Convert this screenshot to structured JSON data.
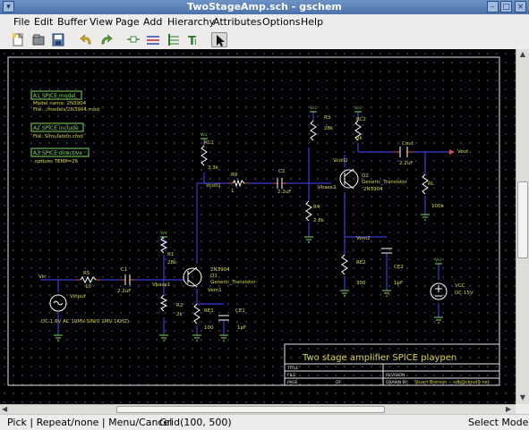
{
  "window": {
    "title": "TwoStageAmp.sch - gschem"
  },
  "menu": [
    "File",
    "Edit",
    "Buffer",
    "View",
    "Page",
    "Add",
    "Hierarchy",
    "Attributes",
    "Options",
    "Help"
  ],
  "toolbar": {
    "buttons": [
      "new-file-icon",
      "open-file-icon",
      "save-icon",
      "undo-icon",
      "redo-icon",
      "add-component-icon",
      "add-net-icon",
      "add-bus-icon",
      "add-text-icon",
      "select-pointer-icon"
    ]
  },
  "schematic": {
    "spice_blocks": [
      {
        "head": "A1  SPICE model",
        "l1": "Model name: 2N3904",
        "l2": "File: ./models/2N3904.mod"
      },
      {
        "head": "A2  SPICE include",
        "l1": "File: Simulation.cmd",
        "l2": ""
      },
      {
        "head": "A3  SPICE directive",
        "l1": ".options TEMP=25",
        "l2": ""
      }
    ],
    "labels": {
      "vin": "Vin",
      "vinput": "Vinput",
      "vsrc_value": "DC 1.6V AC 10MV SIN(0 1MV 1KHZ)",
      "r5": "R5",
      "r5v": "10",
      "c1": "C1",
      "c1v": "2.2uF",
      "vbase1": "Vbase1",
      "r1": "R1",
      "r1v": "28k",
      "r2": "R2",
      "r2v": "2k",
      "rc1": "RC1",
      "rc1v": "3.3k",
      "vcoll1": "Vcoll1",
      "q1a": "2N3904",
      "q1b": "Q1",
      "q1c": "Generic_Transistor",
      "vem1": "Vem1",
      "re1": "RE1",
      "re1v": "100",
      "ce1": "CE1",
      "ce1v": "1pF",
      "r8": "R8",
      "r8v": "1",
      "c2": "C2",
      "c2v": "2.2uF",
      "vbase2": "Vbase2",
      "r3": "R3",
      "r3v": "28k",
      "r4": "R4",
      "r4v": "2.8k",
      "rc2": "RC2",
      "rc2v": "3k",
      "vcoll2": "Vcoll2",
      "q2a": "Q2",
      "q2b": "Generic_Transistor",
      "q2c": "2N3904",
      "vem2": "Vem2",
      "re2": "RE2",
      "re2v": "300",
      "ce2": "CE2",
      "ce2v": "1pF",
      "cout": "Cout",
      "coutv": "2.2uF",
      "vout": "Vout",
      "rl": "RL",
      "rlv": "100k",
      "vcc": "VCC",
      "vccv": "DC 15V",
      "vcc_label": "Vcc"
    },
    "titleblock": {
      "title": "Two stage amplifier SPICE  playpen",
      "file_label": "FILE:",
      "page_label": "PAGE",
      "of_label": "OF",
      "title_label": "TITLE",
      "revision_label": "REVISION",
      "drawn_label": "DRAWN BY:",
      "drawn_by": "Stuart Brorson -- sdb@cloud9.net"
    }
  },
  "status": {
    "mouse": "Pick | Repeat/none | Menu/Cancel",
    "grid": "Grid(100, 500)",
    "mode": "Select Mode"
  }
}
